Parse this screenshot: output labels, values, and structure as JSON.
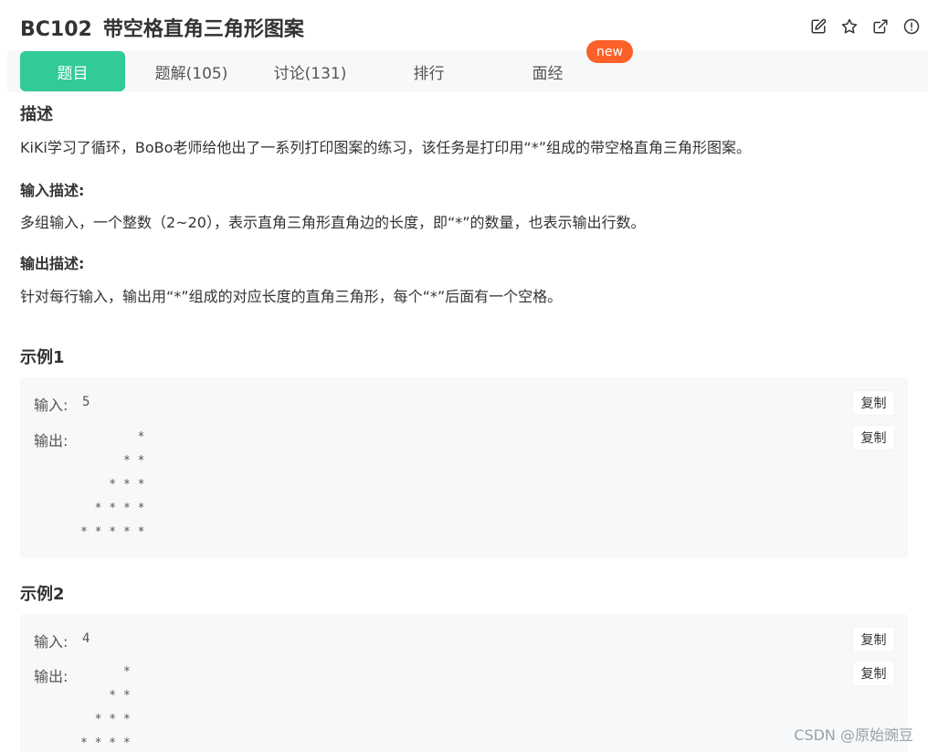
{
  "header": {
    "code": "BC102",
    "title": "带空格直角三角形图案",
    "icons": [
      "edit-icon",
      "star-icon",
      "external-link-icon",
      "report-icon"
    ]
  },
  "tabs": [
    {
      "label": "题目",
      "active": true
    },
    {
      "label": "题解(105)",
      "active": false
    },
    {
      "label": "讨论(131)",
      "active": false
    },
    {
      "label": "排行",
      "active": false
    },
    {
      "label": "面经",
      "active": false
    }
  ],
  "badge": "new",
  "description": {
    "heading": "描述",
    "text": "KiKi学习了循环，BoBo老师给他出了一系列打印图案的练习，该任务是打印用“*”组成的带空格直角三角形图案。"
  },
  "input_desc": {
    "heading": "输入描述:",
    "text": "多组输入，一个整数（2~20），表示直角三角形直角边的长度，即“*”的数量，也表示输出行数。"
  },
  "output_desc": {
    "heading": "输出描述:",
    "text": "针对每行输入，输出用“*”组成的对应长度的直角三角形，每个“*”后面有一个空格。"
  },
  "examples": [
    {
      "heading": "示例1",
      "input_label": "输入:",
      "input_value": "5",
      "output_label": "输出:",
      "output_value": "        * \n      * * \n    * * * \n  * * * * \n* * * * * ",
      "copy_label": "复制"
    },
    {
      "heading": "示例2",
      "input_label": "输入:",
      "input_value": "4",
      "output_label": "输出:",
      "output_value": "      * \n    * * \n  * * * \n* * * * ",
      "copy_label": "复制"
    }
  ],
  "watermark": "CSDN @原始豌豆",
  "colors": {
    "accent": "#32ca99",
    "badge": "#fb6128",
    "panel": "#f7f8fa"
  }
}
